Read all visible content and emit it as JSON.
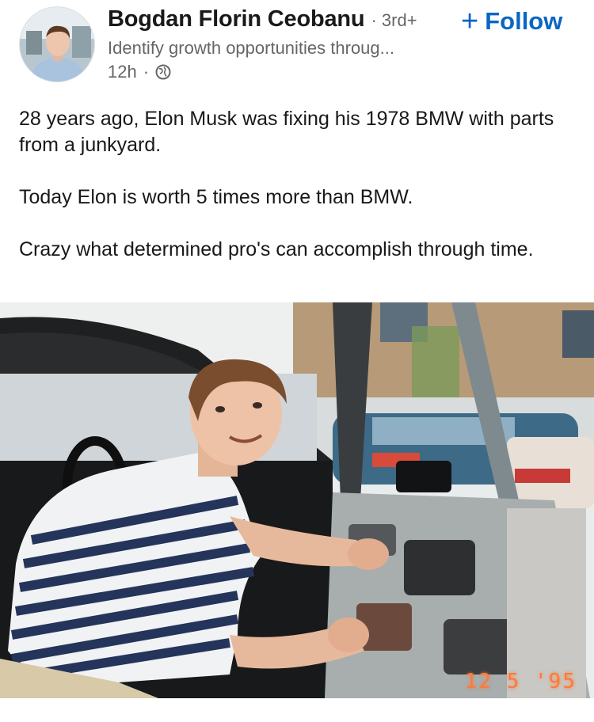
{
  "post": {
    "author": {
      "name": "Bogdan Florin Ceobanu",
      "degree": "· 3rd+",
      "headline": "Identify growth opportunities throug...",
      "time": "12h",
      "separator": "·"
    },
    "follow": {
      "plus": "+",
      "label": "Follow"
    },
    "text": {
      "p1": "28 years ago, Elon Musk was fixing his 1978 BMW with parts from a junkyard.",
      "p2": "Today Elon is worth 5 times more than BMW.",
      "p3": "Crazy what determined pro's can accomplish through time."
    },
    "image": {
      "date_stamp": "12  5 '95"
    }
  },
  "colors": {
    "accent": "#0a66c2",
    "text_primary": "#191919",
    "text_secondary": "#666666"
  },
  "icons": [
    "globe-icon",
    "plus-icon"
  ]
}
